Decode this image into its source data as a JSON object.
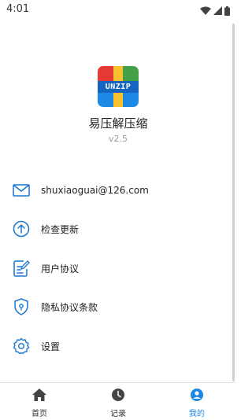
{
  "status_bar": {
    "time": "4:01",
    "icons": [
      "wifi-icon",
      "signal-icon",
      "battery-icon"
    ]
  },
  "app": {
    "logo_text": "UNZIP",
    "name": "易压解压缩",
    "version": "v2.5"
  },
  "menu": [
    {
      "icon": "mail-icon",
      "label": "shuxiaoguai@126.com"
    },
    {
      "icon": "update-arrow-icon",
      "label": "检查更新"
    },
    {
      "icon": "document-edit-icon",
      "label": "用户协议"
    },
    {
      "icon": "shield-icon",
      "label": "隐私协议条款"
    },
    {
      "icon": "gear-icon",
      "label": "设置"
    }
  ],
  "bottom_nav": {
    "items": [
      {
        "icon": "home-icon",
        "label": "首页"
      },
      {
        "icon": "clock-icon",
        "label": "记录"
      },
      {
        "icon": "user-icon",
        "label": "我的"
      }
    ],
    "active_index": 2
  },
  "colors": {
    "accent": "#1e88e5",
    "icon_blue": "#1976d2"
  }
}
